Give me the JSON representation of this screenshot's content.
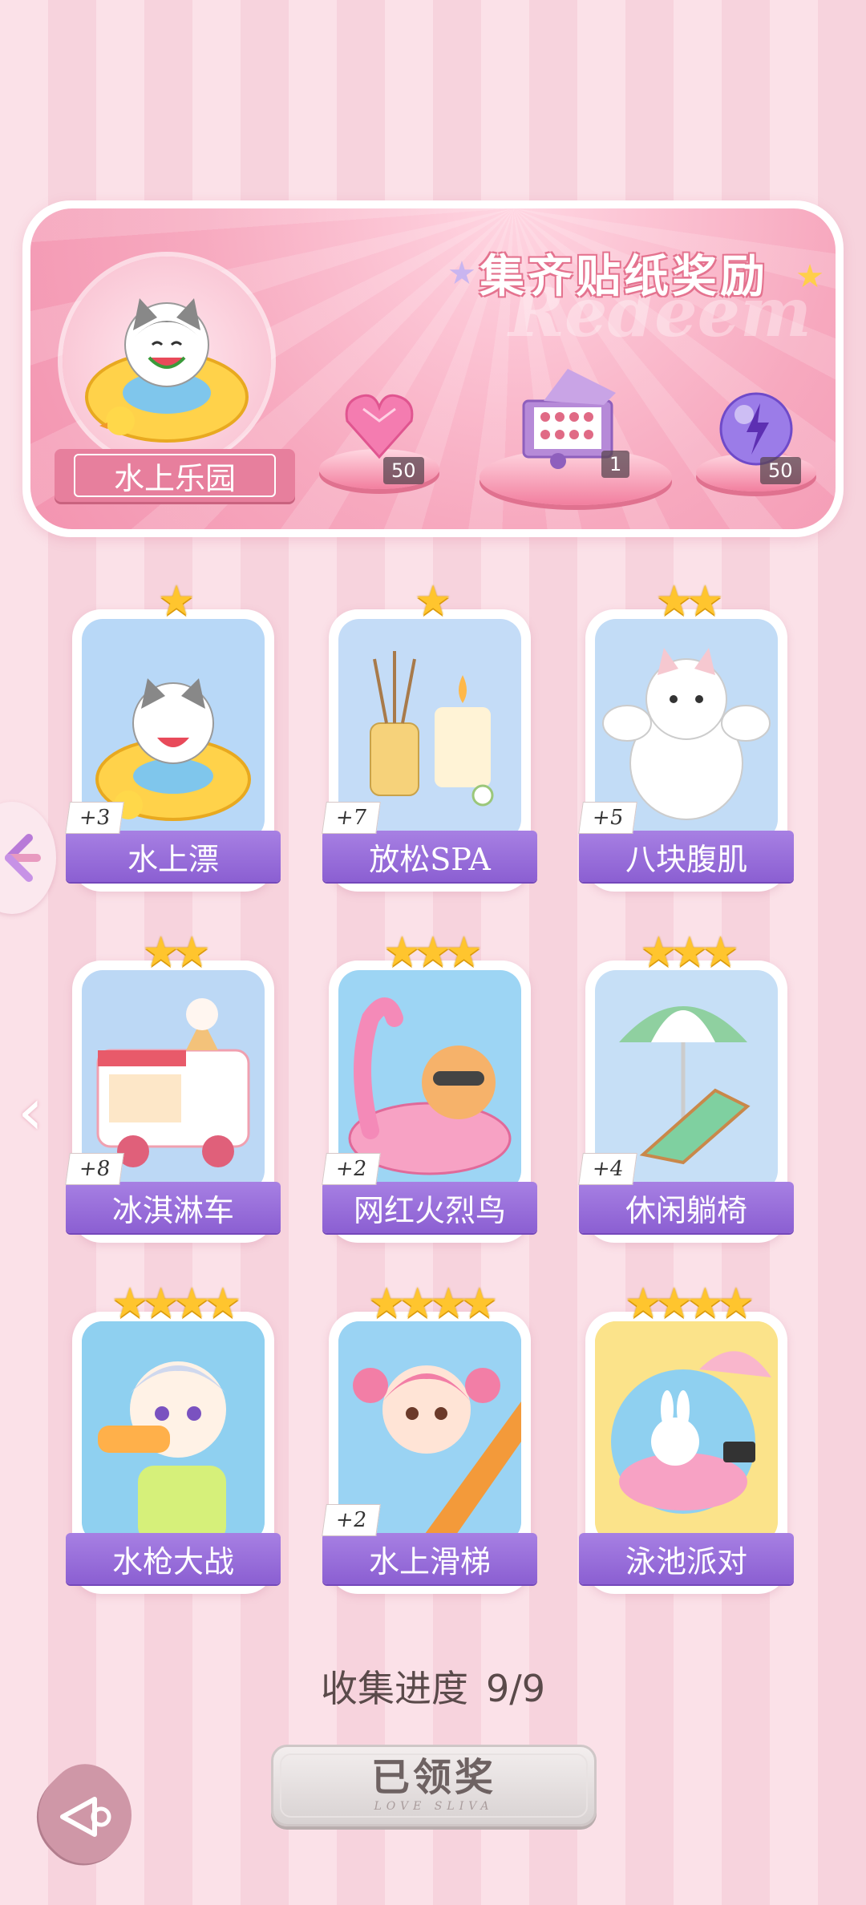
{
  "banner": {
    "title": "集齐贴纸奖励",
    "watermark": "Redeem",
    "zone_name": "水上乐园",
    "rewards": [
      {
        "icon": "pink-diamond-heart-icon",
        "count": "50"
      },
      {
        "icon": "gift-box-icon",
        "count": "1"
      },
      {
        "icon": "purple-energy-orb-icon",
        "count": "50"
      }
    ]
  },
  "cards": [
    {
      "name": "水上漂",
      "bonus": "+3",
      "stars": 1,
      "icon": "cat-swim-ring-icon"
    },
    {
      "name": "放松SPA",
      "bonus": "+7",
      "stars": 1,
      "icon": "spa-candle-icon"
    },
    {
      "name": "八块腹肌",
      "bonus": "+5",
      "stars": 2,
      "icon": "muscle-cat-icon"
    },
    {
      "name": "冰淇淋车",
      "bonus": "+8",
      "stars": 2,
      "icon": "ice-cream-truck-icon"
    },
    {
      "name": "网红火烈鸟",
      "bonus": "+2",
      "stars": 3,
      "icon": "flamingo-float-icon"
    },
    {
      "name": "休闲躺椅",
      "bonus": "+4",
      "stars": 3,
      "icon": "beach-chair-icon"
    },
    {
      "name": "水枪大战",
      "bonus": "",
      "stars": 4,
      "icon": "water-gun-boy-icon"
    },
    {
      "name": "水上滑梯",
      "bonus": "+2",
      "stars": 4,
      "icon": "water-slide-girl-icon"
    },
    {
      "name": "泳池派对",
      "bonus": "",
      "stars": 4,
      "icon": "pool-party-bunny-icon"
    }
  ],
  "progress": {
    "label": "收集进度",
    "value": "9/9"
  },
  "claim_button": {
    "label": "已领奖",
    "sub": "LOVE SLIVA"
  },
  "colors": {
    "card_label": "#8b5fd2",
    "banner_pink": "#f394b0",
    "star": "#ffc52e"
  }
}
